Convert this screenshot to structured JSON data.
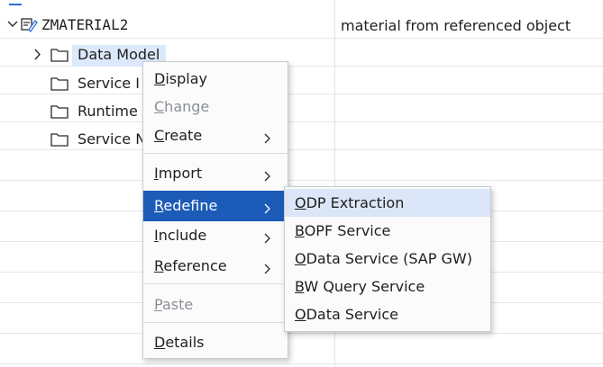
{
  "tree": {
    "root": {
      "title": "ZMATERIAL2",
      "description": "material from referenced object",
      "icon": "package-edit-icon",
      "expanded": true
    },
    "children": [
      {
        "label": "Data Model",
        "icon": "folder-icon",
        "expandable": true,
        "selected": true
      },
      {
        "label": "Service I",
        "icon": "folder-icon",
        "expandable": false
      },
      {
        "label": "Runtime",
        "icon": "folder-icon",
        "expandable": false
      },
      {
        "label": "Service N",
        "icon": "folder-icon",
        "expandable": false
      }
    ]
  },
  "context_menu": {
    "items": [
      {
        "label": "Display",
        "mnemonic": "D",
        "rest": "isplay",
        "enabled": true,
        "submenu": false
      },
      {
        "label": "Change",
        "mnemonic": "C",
        "rest": "hange",
        "enabled": false,
        "submenu": false
      },
      {
        "label": "Create",
        "mnemonic": "C",
        "rest": "reate",
        "enabled": true,
        "submenu": true
      },
      {
        "label": "Import",
        "mnemonic": "I",
        "rest": "mport",
        "enabled": true,
        "submenu": true
      },
      {
        "label": "Redefine",
        "mnemonic": "R",
        "rest": "edefine",
        "enabled": true,
        "submenu": true,
        "active": true
      },
      {
        "label": "Include",
        "mnemonic": "I",
        "rest": "nclude",
        "enabled": true,
        "submenu": true
      },
      {
        "label": "Reference",
        "mnemonic": "R",
        "rest": "eference",
        "enabled": true,
        "submenu": true
      },
      {
        "label": "Paste",
        "mnemonic": "P",
        "rest": "aste",
        "enabled": false,
        "submenu": false
      },
      {
        "label": "Details",
        "mnemonic": "D",
        "rest": "etails",
        "enabled": true,
        "submenu": false
      }
    ]
  },
  "submenu": {
    "items": [
      {
        "label": "ODP Extraction",
        "mnemonic": "O",
        "rest": "DP Extraction",
        "active": true
      },
      {
        "label": "BOPF Service",
        "mnemonic": "B",
        "rest": "OPF Service"
      },
      {
        "label": "OData Service (SAP GW)",
        "mnemonic": "O",
        "rest": "Data Service (SAP GW)"
      },
      {
        "label": "BW Query Service",
        "mnemonic": "B",
        "rest": "W Query Service"
      },
      {
        "label": "OData Service",
        "mnemonic": "O",
        "rest": "Data Service"
      }
    ]
  },
  "colors": {
    "accent": "#1c5bb7",
    "selection": "#dce9fb",
    "submenu_hover": "#dbe7f8",
    "disabled_text": "#8a8f96"
  }
}
